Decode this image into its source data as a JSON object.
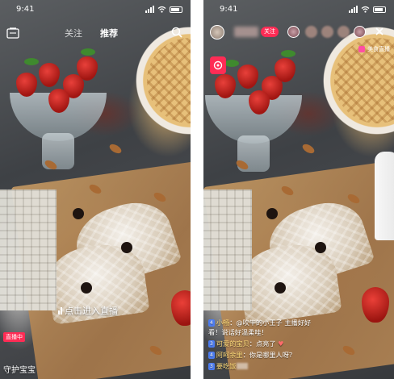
{
  "left": {
    "status_time": "9:41",
    "tabs": [
      {
        "label": "关注",
        "active": false
      },
      {
        "label": "推荐",
        "active": true
      }
    ],
    "enter_live_label": "点击进入直播",
    "live_badge": "直播中",
    "guard_label": "守护宝宝"
  },
  "right": {
    "status_time": "9:41",
    "follow_label": "关注",
    "hot_label": "美食直播",
    "comments": [
      {
        "level": "4",
        "user": "小畅",
        "text": "@吹牛的小王子 主播好好看！说话好温柔哇！"
      },
      {
        "level": "3",
        "user": "可爱的宝贝",
        "text": "点亮了"
      },
      {
        "level": "4",
        "user": "阿呵余里",
        "text": "你是哪里人呀？"
      },
      {
        "level": "3",
        "user": "要吃饭",
        "text": ""
      }
    ]
  },
  "colors": {
    "accent": "#fe2c55",
    "username": "#ffdc7a"
  }
}
